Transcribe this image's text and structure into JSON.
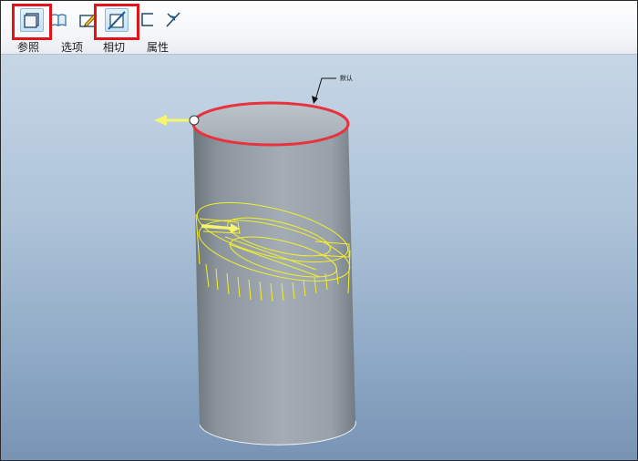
{
  "toolbar": {
    "tabs": [
      {
        "id": "references",
        "label": "参照",
        "icon": "reference-plane-icon",
        "active": true,
        "highlighted": true
      },
      {
        "id": "options",
        "label": "选项",
        "icon": "book-icon",
        "active": false,
        "highlighted": false
      },
      {
        "id": "tangent",
        "label": "相切",
        "icon": "tangent-icon",
        "active": true,
        "highlighted": true
      },
      {
        "id": "properties",
        "label": "属性",
        "icon": "property-arrow-icon",
        "active": false,
        "highlighted": false
      }
    ],
    "extra_icons": [
      "sketch-pencil-icon",
      "bracket-icon"
    ]
  },
  "viewport": {
    "annotation_label": "默认",
    "colors": {
      "cylinder": "#9aa4ad",
      "top_edge": "#e8333f",
      "wireframe": "#f2f02a",
      "direction_arrow": "#f6f56e",
      "highlight_box": "#e0151b"
    }
  }
}
